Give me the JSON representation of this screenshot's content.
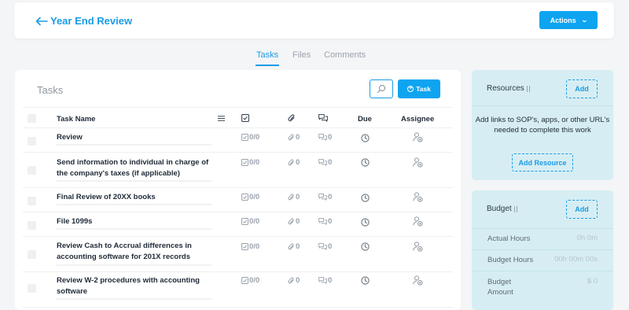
{
  "header": {
    "title": "Year End Review",
    "actions_label": "Actions"
  },
  "tabs": [
    {
      "label": "Tasks",
      "active": true
    },
    {
      "label": "Files",
      "active": false
    },
    {
      "label": "Comments",
      "active": false
    }
  ],
  "tasks_panel": {
    "title": "Tasks",
    "new_task_label": "Task",
    "columns": {
      "name": "Task Name",
      "due": "Due",
      "assignee": "Assignee"
    },
    "rows": [
      {
        "name": "Review",
        "checklist": "0/0",
        "attachments": "0",
        "comments": "0"
      },
      {
        "name": "Send information to individual in charge of the company's taxes (if applicable)",
        "checklist": "0/0",
        "attachments": "0",
        "comments": "0"
      },
      {
        "name": "Final Review of 20XX books",
        "checklist": "0/0",
        "attachments": "0",
        "comments": "0"
      },
      {
        "name": "File 1099s",
        "checklist": "0/0",
        "attachments": "0",
        "comments": "0"
      },
      {
        "name": "Review Cash to Accrual differences in accounting software for 201X records",
        "checklist": "0/0",
        "attachments": "0",
        "comments": "0"
      },
      {
        "name": "Review W-2 procedures with accounting software",
        "checklist": "0/0",
        "attachments": "0",
        "comments": "0"
      }
    ]
  },
  "resources": {
    "title": "Resources",
    "add_label": "Add",
    "description": "Add links to SOP's, apps, or other URL's needed to complete this work",
    "add_resource_label": "Add Resource"
  },
  "budget": {
    "title": "Budget",
    "add_label": "Add",
    "rows": [
      {
        "label": "Actual Hours",
        "value": "0h 0m"
      },
      {
        "label": "Budget Hours",
        "value": "00h 00m 00s"
      },
      {
        "label": "Budget Amount",
        "value": "$ 0"
      }
    ]
  },
  "colors": {
    "accent": "#0fa4f0",
    "link": "#1a9be6",
    "side_panel": "#d6eef3",
    "muted": "#9aa3ad"
  }
}
